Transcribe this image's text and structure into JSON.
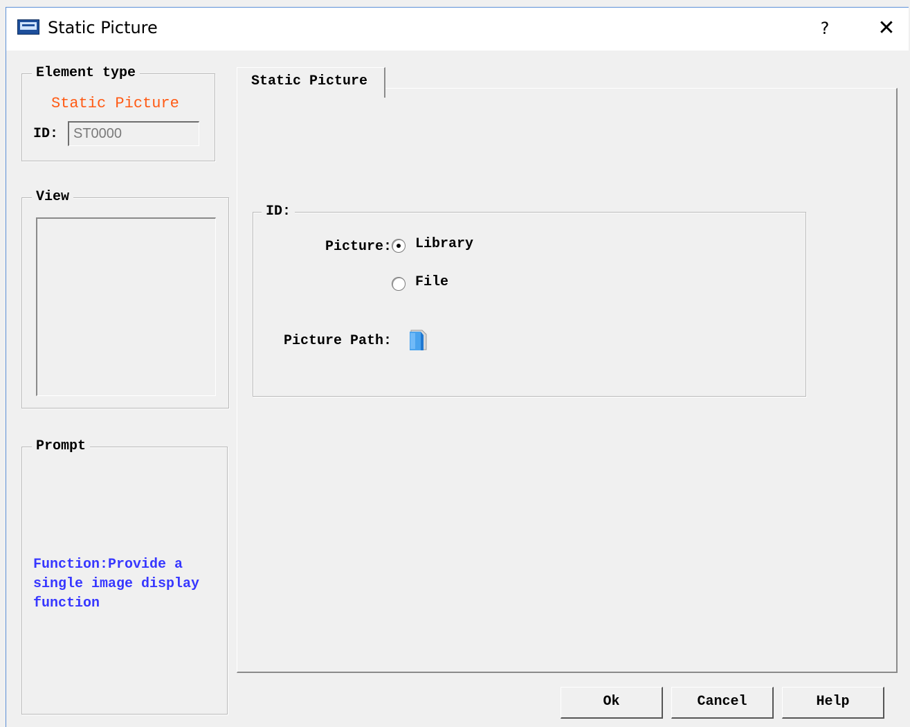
{
  "window": {
    "title": "Static Picture",
    "help_label": "?",
    "close_label": "✕"
  },
  "element_type": {
    "group_title": "Element type",
    "type_name": "Static Picture",
    "id_label": "ID:",
    "id_value": "ST0000"
  },
  "view": {
    "group_title": "View"
  },
  "prompt": {
    "group_title": "Prompt",
    "text": "Function:Provide a single image display function"
  },
  "tab": {
    "label": "Static Picture"
  },
  "id_group": {
    "title": "ID:",
    "picture_label": "Picture:",
    "radio_library": "Library",
    "radio_file": "File",
    "picture_selected": "Library",
    "picture_path_label": "Picture Path:"
  },
  "buttons": {
    "ok": "Ok",
    "cancel": "Cancel",
    "help": "Help"
  },
  "colors": {
    "accent_orange": "#ff5a14",
    "prompt_blue": "#3737ff",
    "title_border": "#5b8fd6"
  },
  "icons": {
    "app": "hmi-app-icon",
    "help": "question-icon",
    "close": "close-icon",
    "picture_path": "folder-blue-icon"
  }
}
